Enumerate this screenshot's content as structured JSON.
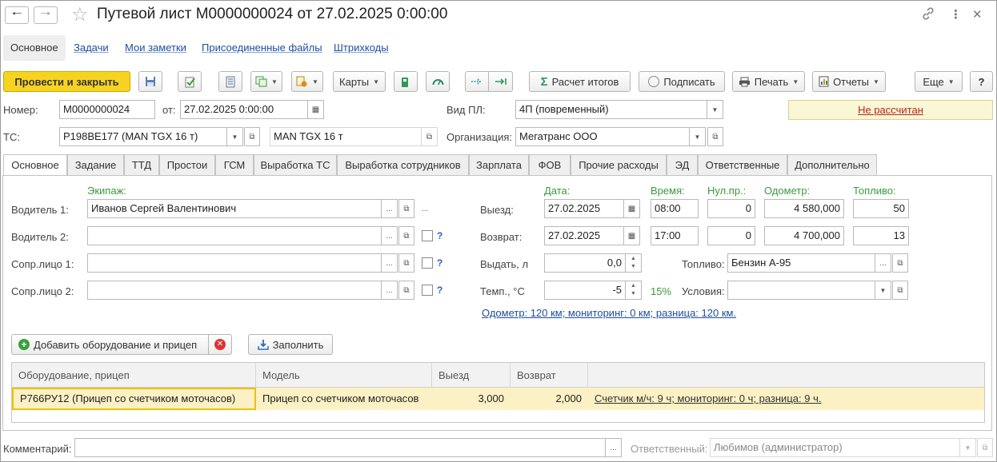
{
  "window": {
    "title": "Путевой лист М0000000024 от 27.02.2025 0:00:00"
  },
  "top_tabs": [
    "Основное",
    "Задачи",
    "Мои заметки",
    "Присоединенные файлы",
    "Штрихкоды"
  ],
  "toolbar": {
    "post_close": "Провести и закрыть",
    "cards": "Карты",
    "calc": "Расчет итогов",
    "sign": "Подписать",
    "print": "Печать",
    "reports": "Отчеты",
    "more": "Еще",
    "help": "?"
  },
  "header": {
    "number_label": "Номер:",
    "number_value": "М0000000024",
    "from_label": "от:",
    "date_value": "27.02.2025  0:00:00",
    "vid_label": "Вид ПЛ:",
    "vid_value": "4П (повременный)",
    "status": "Не рассчитан",
    "ts_label": "ТС:",
    "ts_value": "Р198ВЕ177 (MAN TGX 16 т)",
    "ts_model": "MAN TGX 16 т",
    "org_label": "Организация:",
    "org_value": "Мегатранс ООО"
  },
  "inner_tabs": [
    "Основное",
    "Задание",
    "ТТД",
    "Простои",
    "ГСМ",
    "Выработка ТС",
    "Выработка сотрудников",
    "Зарплата",
    "ФОВ",
    "Прочие расходы",
    "ЭД",
    "Ответственные",
    "Дополнительно"
  ],
  "crew": {
    "header": "Экипаж:",
    "driver1_label": "Водитель 1:",
    "driver1_value": "Иванов Сергей Валентинович",
    "driver2_label": "Водитель 2:",
    "escort1_label": "Сопр.лицо 1:",
    "escort2_label": "Сопр.лицо 2:",
    "help": "?"
  },
  "trip": {
    "date_header": "Дата:",
    "time_header": "Время:",
    "zero_header": "Нул.пр.:",
    "odo_header": "Одометр:",
    "fuel_header": "Топливо:",
    "depart_label": "Выезд:",
    "depart_date": "27.02.2025",
    "depart_time": "08:00",
    "depart_zero": "0",
    "depart_odo": "4 580,000",
    "depart_fuel": "50",
    "return_label": "Возврат:",
    "return_date": "27.02.2025",
    "return_time": "17:00",
    "return_zero": "0",
    "return_odo": "4 700,000",
    "return_fuel": "13",
    "issue_label": "Выдать, л",
    "issue_value": "0,0",
    "temp_label": "Темп., °С",
    "temp_value": "-5",
    "percent": "15%",
    "fuel_label": "Топливо:",
    "fuel_value": "Бензин А-95",
    "cond_label": "Условия:",
    "odometer_note": "Одометр: 120 км;  мониторинг: 0 км;  разница: 120 км."
  },
  "equipment": {
    "add_button": "Добавить оборудование и прицеп",
    "fill_button": "Заполнить",
    "columns": [
      "Оборудование, прицеп",
      "Модель",
      "Выезд",
      "Возврат"
    ],
    "rows": [
      {
        "item": "Р766РУ12 (Прицеп со счетчиком моточасов)",
        "model": "Прицеп со счетчиком моточасов",
        "out": "3,000",
        "back": "2,000",
        "note": "Счетчик м/ч: 9 ч;  мониторинг: 0 ч;  разница: 9 ч."
      }
    ]
  },
  "footer": {
    "comment_label": "Комментарий:",
    "responsible_label": "Ответственный:",
    "responsible_value": "Любимов (администратор)"
  }
}
